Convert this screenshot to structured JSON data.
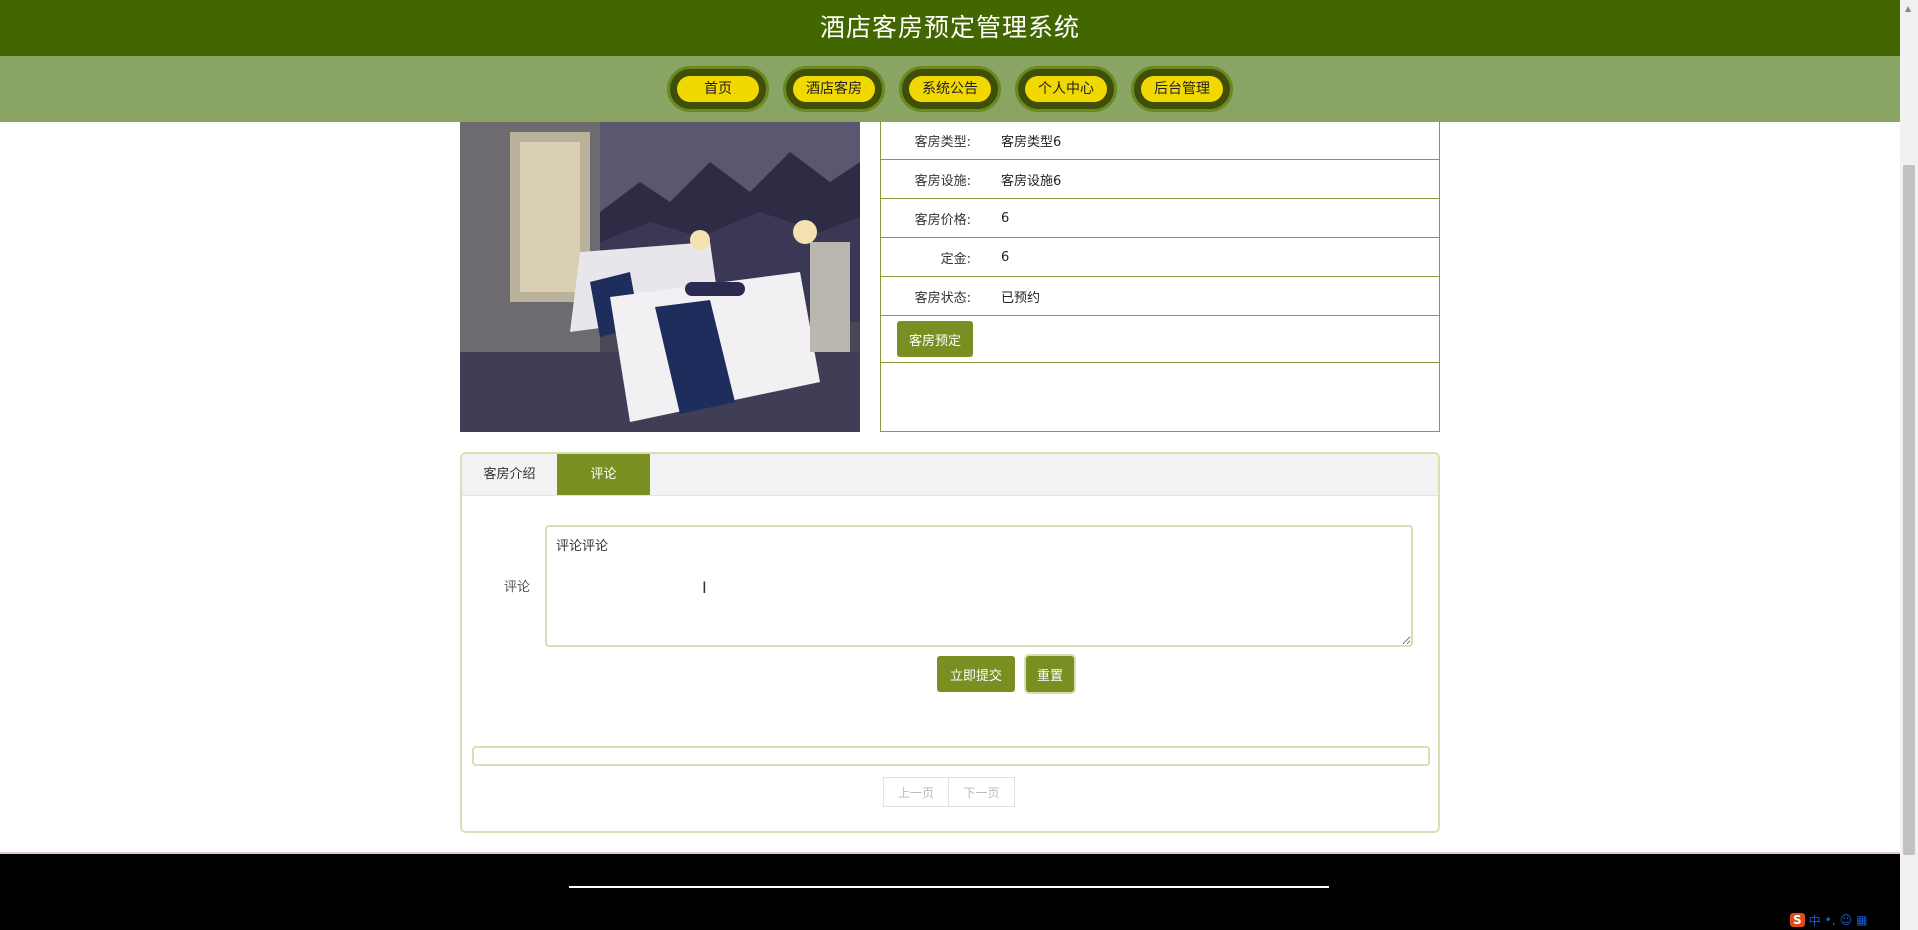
{
  "header": {
    "title": "酒店客房预定管理系统"
  },
  "nav": {
    "items": [
      {
        "label": "首页"
      },
      {
        "label": "酒店客房"
      },
      {
        "label": "系统公告"
      },
      {
        "label": "个人中心"
      },
      {
        "label": "后台管理"
      }
    ]
  },
  "room": {
    "fields": [
      {
        "label": "客房类型:",
        "value": "客房类型6"
      },
      {
        "label": "客房设施:",
        "value": "客房设施6"
      },
      {
        "label": "客房价格:",
        "value": "6"
      },
      {
        "label": "定金:",
        "value": "6"
      },
      {
        "label": "客房状态:",
        "value": "已预约"
      }
    ],
    "book_button": "客房预定"
  },
  "tabs": [
    {
      "label": "客房介绍",
      "active": false
    },
    {
      "label": "评论",
      "active": true
    }
  ],
  "comment": {
    "label": "评论",
    "value": "评论评论",
    "submit_label": "立即提交",
    "reset_label": "重置"
  },
  "pager": {
    "prev": "上一页",
    "next": "下一页"
  },
  "colors": {
    "header_bg": "#426600",
    "nav_bg": "#8aa464",
    "accent": "#7a8f22",
    "pill": "#f0d800"
  },
  "ime": {
    "label": "中"
  }
}
